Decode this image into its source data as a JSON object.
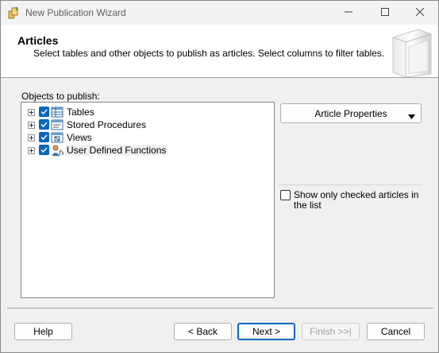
{
  "window": {
    "title": "New Publication Wizard",
    "icon": "wizard-app-icon"
  },
  "header": {
    "title": "Articles",
    "subtitle": "Select tables and other objects to publish as articles. Select columns to filter tables."
  },
  "objects": {
    "label": "Objects to publish:",
    "items": [
      {
        "label": "Tables",
        "checked": true,
        "icon": "table-icon"
      },
      {
        "label": "Stored Procedures",
        "checked": true,
        "icon": "stored-procedure-icon"
      },
      {
        "label": "Views",
        "checked": true,
        "icon": "view-icon"
      },
      {
        "label": "User Defined Functions",
        "checked": true,
        "icon": "function-icon"
      }
    ]
  },
  "article_properties": {
    "label": "Article Properties"
  },
  "show_only_checked": {
    "label": "Show only checked articles in the list",
    "checked": false
  },
  "buttons": {
    "help": "Help",
    "back": "< Back",
    "next": "Next >",
    "finish": "Finish >>|",
    "cancel": "Cancel"
  },
  "colors": {
    "accent": "#0067c0",
    "background": "#f0f0f0"
  }
}
